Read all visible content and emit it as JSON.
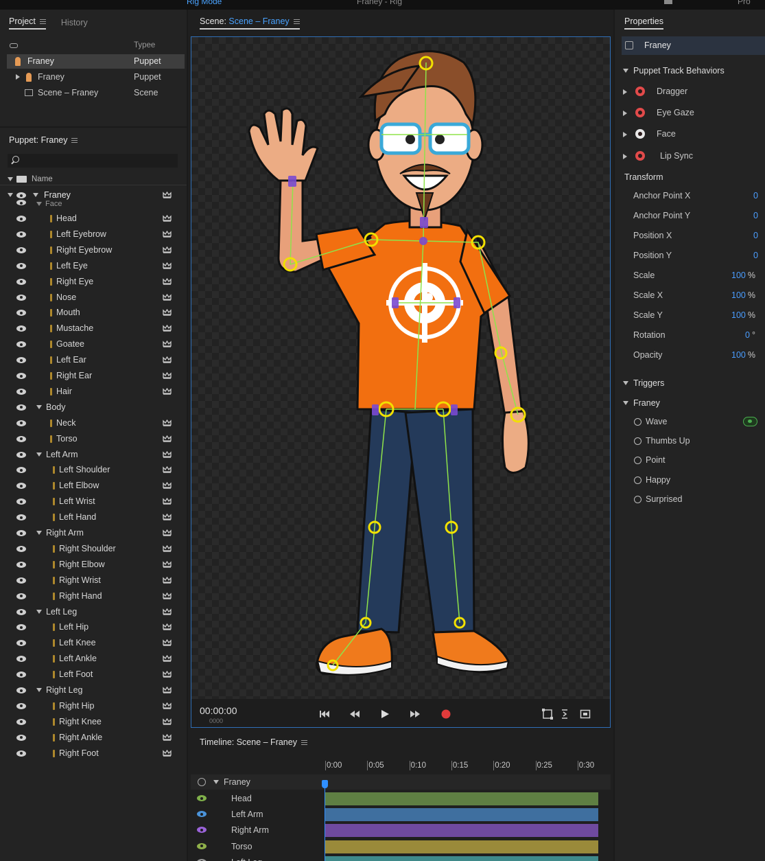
{
  "topbar": {
    "mode": "Rig Mode",
    "title": "Franey - Rig",
    "right": "Pro"
  },
  "project": {
    "tabs": [
      "Project",
      "History"
    ],
    "type_header": "Typee",
    "items": [
      {
        "name": "Franey",
        "type": "Puppet",
        "selected": true
      },
      {
        "name": "Franey",
        "type": "Puppet",
        "selected": false
      },
      {
        "name": "Scene – Franey",
        "type": "Scene",
        "selected": false
      }
    ]
  },
  "puppet_panel": {
    "title": "Puppet: Franey",
    "name_header": "Name",
    "root": "Franey",
    "face_group": "Face",
    "rows": [
      {
        "label": "Head",
        "kind": "layer"
      },
      {
        "label": "Left Eyebrow",
        "kind": "layer"
      },
      {
        "label": "Right Eyebrow",
        "kind": "layer"
      },
      {
        "label": "Left Eye",
        "kind": "layer"
      },
      {
        "label": "Right Eye",
        "kind": "layer"
      },
      {
        "label": "Nose",
        "kind": "layer"
      },
      {
        "label": "Mouth",
        "kind": "layer"
      },
      {
        "label": "Mustache",
        "kind": "layer"
      },
      {
        "label": "Goatee",
        "kind": "layer"
      },
      {
        "label": "Left Ear",
        "kind": "layer"
      },
      {
        "label": "Right Ear",
        "kind": "layer"
      },
      {
        "label": "Hair",
        "kind": "layer"
      },
      {
        "label": "Body",
        "kind": "group"
      },
      {
        "label": "Neck",
        "kind": "layer"
      },
      {
        "label": "Torso",
        "kind": "layer"
      },
      {
        "label": "Left Arm",
        "kind": "group"
      },
      {
        "label": "Left Shoulder",
        "kind": "sub"
      },
      {
        "label": "Left Elbow",
        "kind": "sub"
      },
      {
        "label": "Left Wrist",
        "kind": "sub"
      },
      {
        "label": "Left Hand",
        "kind": "sub"
      },
      {
        "label": "Right Arm",
        "kind": "group"
      },
      {
        "label": "Right Shoulder",
        "kind": "sub"
      },
      {
        "label": "Right Elbow",
        "kind": "sub"
      },
      {
        "label": "Right Wrist",
        "kind": "sub"
      },
      {
        "label": "Right Hand",
        "kind": "sub"
      },
      {
        "label": "Left Leg",
        "kind": "group"
      },
      {
        "label": "Left Hip",
        "kind": "sub"
      },
      {
        "label": "Left Knee",
        "kind": "sub"
      },
      {
        "label": "Left Ankle",
        "kind": "sub"
      },
      {
        "label": "Left Foot",
        "kind": "sub"
      },
      {
        "label": "Right Leg",
        "kind": "group"
      },
      {
        "label": "Right Hip",
        "kind": "sub"
      },
      {
        "label": "Right Knee",
        "kind": "sub"
      },
      {
        "label": "Right Ankle",
        "kind": "sub"
      },
      {
        "label": "Right Foot",
        "kind": "sub"
      }
    ]
  },
  "scene": {
    "tab_prefix": "Scene:",
    "tab_name": "Scene – Franey",
    "timecode": "00:00:00",
    "frame": "0000"
  },
  "timeline": {
    "title": "Timeline: Scene – Franey",
    "ticks": [
      "0:00",
      "0:05",
      "0:10",
      "0:15",
      "0:20",
      "0:25",
      "0:30"
    ],
    "group": "Franey",
    "tracks": [
      {
        "label": "Head",
        "color": "#5f7f43",
        "eye": "#7fb04a"
      },
      {
        "label": "Left Arm",
        "color": "#3f6f9f",
        "eye": "#4a92d8"
      },
      {
        "label": "Right Arm",
        "color": "#6f4a9f",
        "eye": "#9a63d8"
      },
      {
        "label": "Torso",
        "color": "#9a8a3a",
        "eye": "#8fb04a"
      },
      {
        "label": "Left Leg",
        "color": "#3f8a8a",
        "eye": "#9a9a9a"
      }
    ]
  },
  "properties": {
    "tab": "Properties",
    "selected": "Franey",
    "behaviors_header": "Puppet Track Behaviors",
    "behaviors": [
      {
        "label": "Dragger",
        "icon": "red"
      },
      {
        "label": "Eye Gaze",
        "icon": "red"
      },
      {
        "label": "Face",
        "icon": "white"
      },
      {
        "label": "Lip Sync",
        "icon": "red"
      }
    ],
    "transform_header": "Transform",
    "transform": [
      {
        "label": "Anchor Point X",
        "value": "0",
        "unit": ""
      },
      {
        "label": "Anchor Point Y",
        "value": "0",
        "unit": ""
      },
      {
        "label": "Position X",
        "value": "0",
        "unit": ""
      },
      {
        "label": "Position Y",
        "value": "0",
        "unit": ""
      },
      {
        "label": "Scale",
        "value": "100",
        "unit": "%"
      },
      {
        "label": "Scale X",
        "value": "100",
        "unit": "%"
      },
      {
        "label": "Scale Y",
        "value": "100",
        "unit": "%"
      },
      {
        "label": "Rotation",
        "value": "0",
        "unit": "°"
      },
      {
        "label": "Opacity",
        "value": "100",
        "unit": "%"
      }
    ],
    "triggers_header": "Triggers",
    "triggers_group": "Franey",
    "triggers": [
      "Wave",
      "Thumbs Up",
      "Point",
      "Happy",
      "Surprised"
    ],
    "accent": "#4a9dff"
  }
}
